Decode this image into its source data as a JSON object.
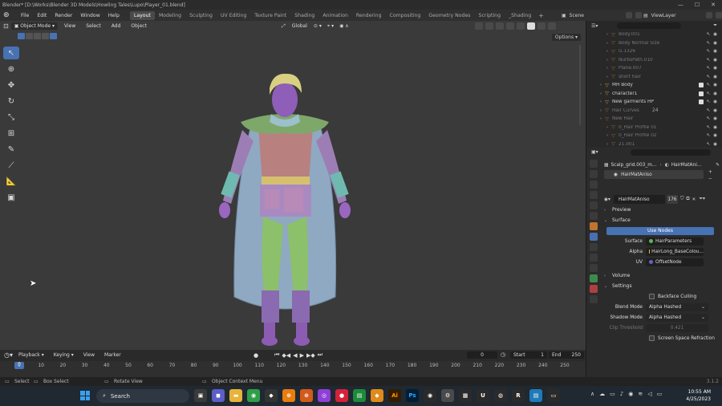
{
  "titlebar": {
    "text": "Blender* [D:\\Works\\Blender 3D Models\\Howling Tales\\Lupo\\Player_01.blend]",
    "minimize": "—",
    "maximize": "☐",
    "close": "✕"
  },
  "menubar": {
    "items": [
      "File",
      "Edit",
      "Render",
      "Window",
      "Help"
    ],
    "workspaces": [
      "Layout",
      "Modeling",
      "Sculpting",
      "UV Editing",
      "Texture Paint",
      "Shading",
      "Animation",
      "Rendering",
      "Compositing",
      "Geometry Nodes",
      "Scripting",
      "_Shading"
    ],
    "active_workspace": "Layout",
    "scene": "Scene",
    "view_layer": "ViewLayer"
  },
  "viewport": {
    "mode": "Object Mode",
    "menus": [
      "View",
      "Select",
      "Add",
      "Object"
    ],
    "transform_orientation": "Global",
    "options_label": "Options"
  },
  "outliner": {
    "rows": [
      {
        "label": "Body.001",
        "dim": true,
        "indent": 2
      },
      {
        "label": "Body Normal Size",
        "dim": true,
        "indent": 2
      },
      {
        "label": "G.1326",
        "dim": true,
        "indent": 2
      },
      {
        "label": "NurbsPath.010",
        "dim": true,
        "indent": 2
      },
      {
        "label": "Plane.007",
        "dim": true,
        "indent": 2
      },
      {
        "label": "short hair",
        "dim": true,
        "indent": 2
      },
      {
        "label": "MH Body",
        "dim": false,
        "indent": 1
      },
      {
        "label": "character1",
        "dim": false,
        "indent": 1
      },
      {
        "label": "New garments HP",
        "dim": false,
        "indent": 1
      },
      {
        "label": "Hair Curves",
        "dim": true,
        "indent": 1
      },
      {
        "label": "New Hair",
        "dim": true,
        "indent": 1
      },
      {
        "label": "0_Hair Profile 01",
        "dim": true,
        "indent": 2
      },
      {
        "label": "0_Hair Profile 02",
        "dim": true,
        "indent": 2
      },
      {
        "label": "21.001",
        "dim": true,
        "indent": 2
      }
    ],
    "hair_curves_count": "24"
  },
  "properties": {
    "breadcrumb_object": "Scalp_grid.003_m...",
    "breadcrumb_material": "HairMatAni...",
    "slot_name": "HairMatAniso",
    "material_name": "HairMatAniso",
    "user_count": "176",
    "sections": {
      "preview": "Preview",
      "surface": "Surface",
      "volume": "Volume",
      "settings": "Settings"
    },
    "use_nodes_label": "Use Nodes",
    "surface_label": "Surface",
    "surface_value": "HairParameters",
    "alpha_label": "Alpha",
    "alpha_value": "HairLong_BaseColou...",
    "uv_label": "UV",
    "uv_value": "OffsetNode",
    "backface_culling": "Backface Culling",
    "blend_mode_label": "Blend Mode",
    "blend_mode_value": "Alpha Hashed",
    "shadow_mode_label": "Shadow Mode",
    "shadow_mode_value": "Alpha Hashed",
    "clip_threshold_label": "Clip Threshold",
    "clip_threshold_value": "0.421",
    "screen_space_refraction": "Screen Space Refraction"
  },
  "timeline": {
    "menus": [
      "Playback",
      "Keying",
      "View",
      "Marker"
    ],
    "current_frame": "0",
    "start_label": "Start",
    "start_value": "1",
    "end_label": "End",
    "end_value": "250",
    "ticks": [
      "0",
      "10",
      "20",
      "30",
      "40",
      "50",
      "60",
      "70",
      "80",
      "90",
      "100",
      "110",
      "120",
      "130",
      "140",
      "150",
      "160",
      "170",
      "180",
      "190",
      "200",
      "210",
      "220",
      "230",
      "240",
      "250"
    ],
    "playhead": "0"
  },
  "statusbar": {
    "select": "Select",
    "box_select": "Box Select",
    "rotate_view": "Rotate View",
    "context_menu": "Object Context Menu",
    "version": "3.1.2"
  },
  "taskbar": {
    "search_label": "Search",
    "time": "10:55 AM",
    "date": "4/25/2023",
    "app_badges": [
      "Ps",
      "Ai",
      "R"
    ]
  },
  "colors": {
    "accent": "#4772b3",
    "viewport_bg": "#3a3a3a",
    "object_orange": "#e0943c"
  }
}
